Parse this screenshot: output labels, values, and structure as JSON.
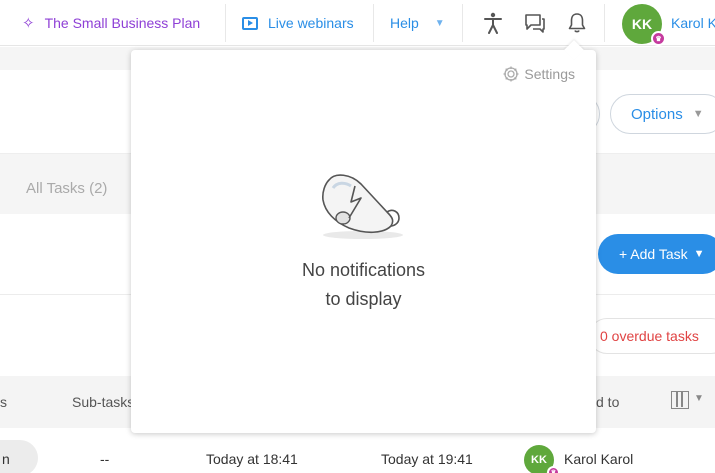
{
  "topbar": {
    "plan_label": "The Small Business Plan",
    "webinars_label": "Live webinars",
    "help_label": "Help",
    "user_initials": "KK",
    "user_name": "Karol K"
  },
  "page": {
    "options_label": "Options",
    "all_tasks_tab": "All Tasks (2)",
    "add_task_label": "+ Add Task",
    "overdue_label": "0 overdue tasks"
  },
  "table": {
    "headers": [
      "s",
      "Sub-tasks",
      "d to"
    ],
    "row": {
      "first_fragment": "n",
      "subtasks": "--",
      "start": "Today at 18:41",
      "due": "Today at 19:41",
      "assignee_initials": "KK",
      "assignee_name": "Karol Karol"
    }
  },
  "notifications": {
    "settings_label": "Settings",
    "empty_line1": "No notifications",
    "empty_line2": "to display"
  },
  "colors": {
    "accent_blue": "#2a8ee6",
    "plan_purple": "#8e3fd6",
    "avatar_green": "#5fa83c",
    "badge_magenta": "#c53a9e",
    "overdue_red": "#e04343"
  },
  "icons": [
    "sparkle-icon",
    "tv-play-icon",
    "chevron-down-icon",
    "accessibility-icon",
    "chat-icon",
    "bell-icon",
    "crown-icon",
    "gear-icon",
    "columns-icon",
    "bell-illustration-icon"
  ]
}
